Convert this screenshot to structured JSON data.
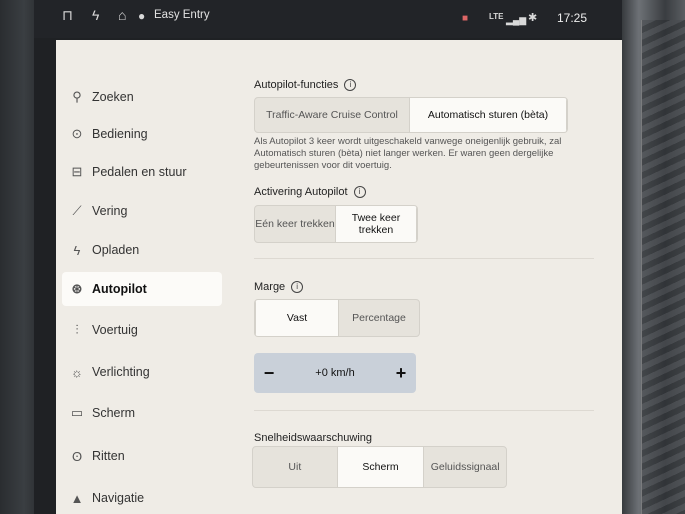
{
  "status": {
    "driver_profile": "Easy Entry",
    "network": "LTE",
    "time": "17:25"
  },
  "sidebar": {
    "items": [
      {
        "label": "Zoeken",
        "icon": "search-icon",
        "glyph": "⚲"
      },
      {
        "label": "Bediening",
        "icon": "toggle-icon",
        "glyph": "⊙"
      },
      {
        "label": "Pedalen en stuur",
        "icon": "car-icon",
        "glyph": "⊟"
      },
      {
        "label": "Vering",
        "icon": "wrench-icon",
        "glyph": "⟋"
      },
      {
        "label": "Opladen",
        "icon": "bolt-icon",
        "glyph": "ϟ"
      },
      {
        "label": "Autopilot",
        "icon": "steering-wheel-icon",
        "glyph": "⊛"
      },
      {
        "label": "Voertuig",
        "icon": "sliders-icon",
        "glyph": "⫶"
      },
      {
        "label": "Verlichting",
        "icon": "light-icon",
        "glyph": "☼"
      },
      {
        "label": "Scherm",
        "icon": "screen-icon",
        "glyph": "▭"
      },
      {
        "label": "Ritten",
        "icon": "trips-icon",
        "glyph": "ʘ"
      },
      {
        "label": "Navigatie",
        "icon": "navigation-icon",
        "glyph": "▲"
      }
    ],
    "active": "Autopilot"
  },
  "autopilot": {
    "features_label": "Autopilot-functies",
    "features_options": [
      "Traffic-Aware Cruise Control",
      "Automatisch sturen (bèta)"
    ],
    "features_selected": "Automatisch sturen (bèta)",
    "features_desc": "Als Autopilot 3 keer wordt uitgeschakeld vanwege oneigenlijk gebruik, zal Automatisch sturen (bèta) niet langer werken. Er waren geen dergelijke gebeurtenissen voor dit voertuig.",
    "activation_label": "Activering Autopilot",
    "activation_options": [
      "Eén keer trekken",
      "Twee keer trekken"
    ],
    "activation_selected": "Twee keer trekken",
    "margin_label": "Marge",
    "margin_options": [
      "Vast",
      "Percentage"
    ],
    "margin_selected": "Vast",
    "margin_value": "+0 km/h",
    "margin_minus": "−",
    "margin_plus": "+",
    "speed_warning_label": "Snelheidswaarschuwing",
    "speed_warning_options": [
      "Uit",
      "Scherm",
      "Geluidssignaal"
    ],
    "speed_warning_selected": "Scherm"
  }
}
